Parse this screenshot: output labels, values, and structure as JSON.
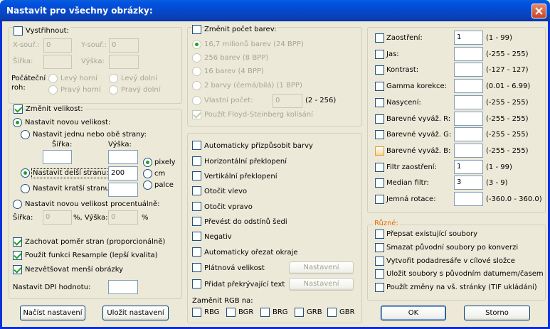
{
  "window": {
    "title": "Nastavit pro všechny obrázky:"
  },
  "crop": {
    "label": "Vystřihnout:",
    "x_label": "X-souř.:",
    "x_value": "0",
    "y_label": "Y-souř.:",
    "y_value": "0",
    "width_label": "Šířka:",
    "width_value": "",
    "height_label": "Výška:",
    "height_value": "",
    "corner_label_1": "Počáteční",
    "corner_label_2": "roh:",
    "corners": [
      "Levý horní",
      "Levý dolní",
      "Pravý horní",
      "Pravý dolní"
    ]
  },
  "resize": {
    "label": "Změnit velikost:",
    "new_size_label": "Nastavit novou velikost:",
    "one_or_both_label": "Nastavit jednu nebo obě strany:",
    "width_label": "Šířka:",
    "height_label": "Výška:",
    "width_value": "",
    "height_value": "",
    "longer_side_label": "Nastavit delší stranu:",
    "longer_side_value": "200",
    "shorter_side_label": "Nastavit kratší stranu:",
    "shorter_side_value": "",
    "units": [
      "pixely",
      "cm",
      "palce"
    ],
    "percent_label": "Nastavit novou velikost procentuálně:",
    "percent_width_label": "Šířka:",
    "percent_width_value": "0",
    "percent_sep_label": "%, Výška:",
    "percent_height_value": "0",
    "percent_sign": "%"
  },
  "options": {
    "keep_ratio": "Zachovat poměr stran (proporcionálně)",
    "resample": "Použít funkci Resample (lepší kvalita)",
    "enlarge": "Nezvětšovat menší obrázky",
    "dpi_label": "Nastavit DPI hodnotu:",
    "dpi_value": ""
  },
  "buttons": {
    "load": "Načíst nastavení",
    "save": "Uložit nastavení",
    "ok": "OK",
    "cancel": "Storno",
    "settings1": "Nastavení",
    "settings2": "Nastavení"
  },
  "colors": {
    "label": "Změnit počet barev:",
    "options": [
      "16,7 milionů barev (24 BPP)",
      "256 barev (8 BPP)",
      "16 barev (4 BPP)",
      "2 barvy (černá/bílá) (1 BPP)"
    ],
    "custom_label": "Vlastní počet:",
    "custom_value": "0",
    "custom_range": "(2 - 256)",
    "floyd": "Použít Floyd-Steinberg kolísání"
  },
  "transforms": {
    "items": [
      "Automaticky přizpůsobit barvy",
      "Horizontální překlopení",
      "Vertikální překlopení",
      "Otočit vlevo",
      "Otočit vpravo",
      "Převést do odstínů šedi",
      "Negativ",
      "Automaticky ořezat okraje",
      "Plátnová velikost",
      "Přidat překrývající text"
    ],
    "rgb_label": "Zaměnit RGB na:",
    "rgb_options": [
      "RBG",
      "BGR",
      "BRG",
      "GRB",
      "GBR"
    ]
  },
  "adjust": {
    "items": [
      {
        "label": "Zaostření:",
        "value": "1",
        "range": "(1  -  99)"
      },
      {
        "label": "Jas:",
        "value": "",
        "range": "(-255  -  255)"
      },
      {
        "label": "Kontrast:",
        "value": "",
        "range": "(-127  -  127)"
      },
      {
        "label": "Gamma korekce:",
        "value": "",
        "range": "(0.01  -  6.99)"
      },
      {
        "label": "Nasycení:",
        "value": "",
        "range": "(-255  -  255)"
      },
      {
        "label": "Barevné vyváž. R:",
        "value": "",
        "range": "(-255  -  255)"
      },
      {
        "label": "Barevné vyváž. G:",
        "value": "",
        "range": "(-255  -  255)"
      },
      {
        "label": "Barevné vyváž. B:",
        "value": "",
        "range": "(-255  -  255)"
      },
      {
        "label": "Filtr zaostření:",
        "value": "1",
        "range": "(1  -  99)"
      },
      {
        "label": "Median filtr:",
        "value": "3",
        "range": "(3  -  9)"
      },
      {
        "label": "Jemná rotace:",
        "value": "",
        "range": "(-360.0  -  360.0)"
      }
    ]
  },
  "misc": {
    "label": "Různé:",
    "items": [
      "Přepsat existující soubory",
      "Smazat původní soubory po konverzi",
      "Vytvořit podadresáře v cílové složce",
      "Uložit soubory s původním datumem/časem",
      "Použít změny na vš. stránky (TIF ukládání)"
    ]
  }
}
